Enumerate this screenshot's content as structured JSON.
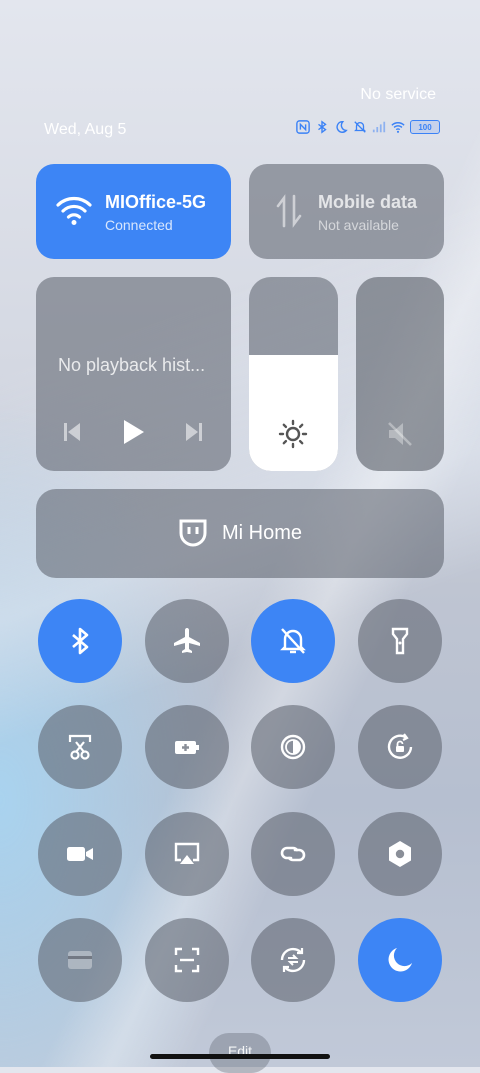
{
  "status": {
    "carrier": "No service",
    "date": "Wed, Aug 5",
    "battery": "100"
  },
  "wifi": {
    "name": "MIOffice-5G",
    "status": "Connected"
  },
  "mobile": {
    "name": "Mobile data",
    "status": "Not available"
  },
  "media": {
    "text": "No playback hist..."
  },
  "brightness": {
    "level": 0.6
  },
  "mihome": {
    "label": "Mi Home"
  },
  "toggles": [
    {
      "name": "bluetooth",
      "on": true
    },
    {
      "name": "airplane-mode",
      "on": false
    },
    {
      "name": "mute",
      "on": true
    },
    {
      "name": "flashlight",
      "on": false
    },
    {
      "name": "screenshot",
      "on": false
    },
    {
      "name": "battery-saver",
      "on": false
    },
    {
      "name": "reading-mode",
      "on": false
    },
    {
      "name": "rotation-lock",
      "on": false
    },
    {
      "name": "video-record",
      "on": false
    },
    {
      "name": "cast",
      "on": false
    },
    {
      "name": "link",
      "on": false
    },
    {
      "name": "settings",
      "on": false
    },
    {
      "name": "card",
      "on": false
    },
    {
      "name": "scanner",
      "on": false
    },
    {
      "name": "sync",
      "on": false
    },
    {
      "name": "dark-mode",
      "on": true
    }
  ],
  "edit": {
    "label": "Edit"
  },
  "colors": {
    "accent": "#3d85f5"
  }
}
